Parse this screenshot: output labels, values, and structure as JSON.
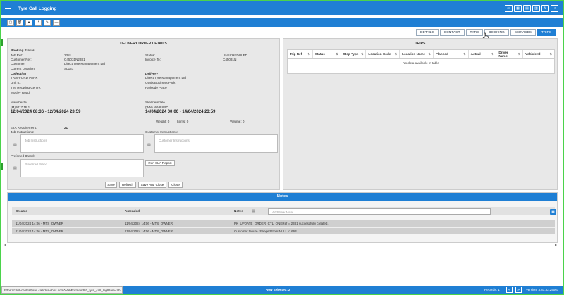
{
  "app": {
    "title": "Tyre Call Logging"
  },
  "toolbar": {
    "icons": [
      "new-icon",
      "delete-icon",
      "info-icon",
      "undo-icon",
      "pen-icon",
      "minus-icon"
    ]
  },
  "tabs": [
    {
      "label": "DETAILS"
    },
    {
      "label": "CONTACT"
    },
    {
      "label": "TYRE"
    },
    {
      "label": "BOOKING"
    },
    {
      "label": "SERVICES"
    },
    {
      "label": "TRIPS",
      "active": true
    }
  ],
  "delivery": {
    "title": "DELIVERY ORDER DETAILS",
    "booking_status": "Booking Status",
    "job_ref_label": "Job Ref:",
    "job_ref": "2381",
    "customer_ref_label": "Customer Ref:",
    "customer_ref": "C45031N2381",
    "customer_label": "Customer:",
    "customer": "Direct Tyre Management Ltd",
    "current_location_label": "Current Location:",
    "current_location": "SL131",
    "status_label": "Status:",
    "status": "UNSCHEDULED",
    "invoice_to_label": "Invoice To:",
    "invoice_to": "C45031N",
    "collection_label": "Collection",
    "collection_lines": [
      "TRAFFORD PARK",
      "Unit 51",
      "The Redwing Centre,",
      "Mosley Road"
    ],
    "collection_city": "Manchester",
    "collection_postcode": "(M) M17 1RJ",
    "collection_time": "12/04/2024 08:36 - 12/04/2024 23:59",
    "delivery_label": "Delivery",
    "delivery_lines": [
      "Direct Tyre Management Ltd",
      "Oasis Business Park",
      "Parkside Place"
    ],
    "delivery_city": "Skelmersdale",
    "delivery_postcode": "(WN) WN8 8RD",
    "delivery_time": "14/04/2024 00:00 - 14/04/2024 23:59",
    "weight": "Weight: 0",
    "items": "Items: 0",
    "volume": "Volume: 0",
    "eta_label": "ETA Requirement:",
    "eta": "2D",
    "job_instructions_label": "Job Instructions:",
    "job_instructions_placeholder": "Job Instructions",
    "customer_instructions_label": "Customer Instructions:",
    "customer_instructions_placeholder": "Customer Instructions",
    "preferred_brand_label": "Preferred Brand:",
    "preferred_brand_placeholder": "Preferred Brand",
    "run_sla": "Run SLA Report",
    "buttons": {
      "save": "Save",
      "refresh": "Refresh",
      "save_close": "Save And Close",
      "close": "Close"
    }
  },
  "trips": {
    "title": "TRIPS",
    "columns": [
      "Trip Ref",
      "Status",
      "Stop Type",
      "Location Code",
      "Location Name",
      "Planned",
      "Actual",
      "Driver Name",
      "Vehicle Id"
    ],
    "empty": "No data available in table"
  },
  "notes": {
    "title": "Notes",
    "col_created": "Created",
    "col_amended": "Amended",
    "col_notes": "Notes",
    "add_placeholder": "Add New Note",
    "rows": [
      {
        "created": "11/04/2024 14:06 - MTS_OWNER",
        "amended": "11/04/2024 14:06 - MTS_OWNER",
        "note": "PK_UPDATE_ORDER_CTL: ONERef = 2381 successfully created."
      },
      {
        "created": "11/04/2024 14:06 - MTS_OWNER",
        "amended": "11/04/2024 14:06 - MTS_OWNER",
        "note": "Customer tenure changed from NULL to 663."
      }
    ]
  },
  "status": {
    "url": "https://ctlist-centraltyres.callidus-chris.com/WebForm/ord02_tyre_call_log#item-tab",
    "row_selected": "Row Selected: 2",
    "records": "Records: 1",
    "version": "Version: 3.81.33.25061"
  }
}
